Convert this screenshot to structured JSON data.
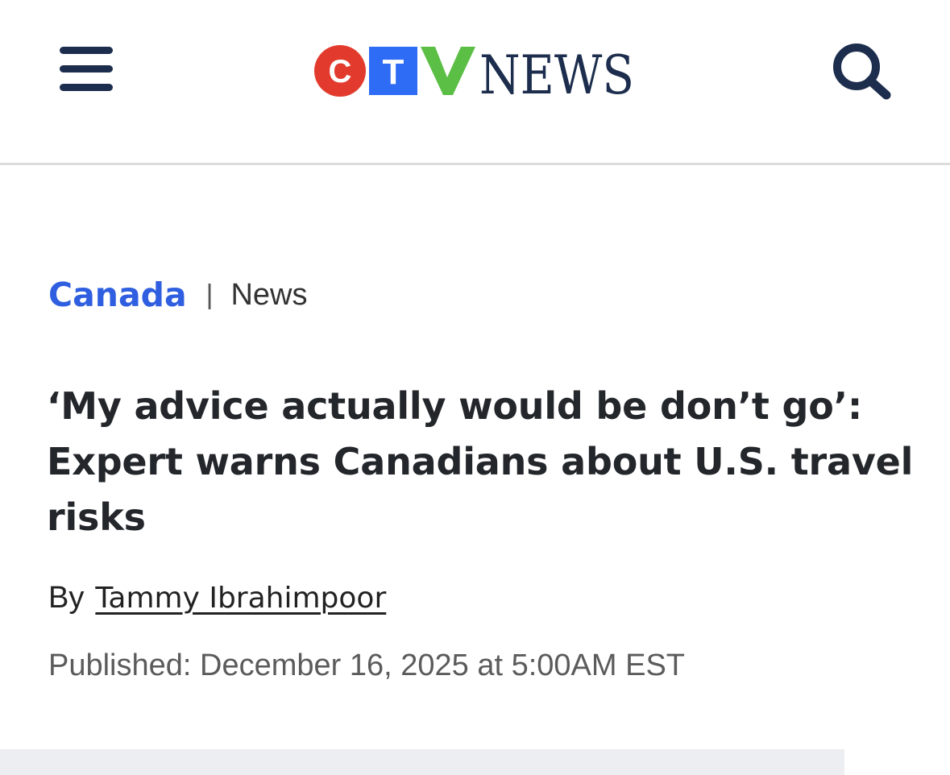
{
  "header": {
    "menu_icon": "hamburger-menu-icon",
    "logo": {
      "letters": [
        "C",
        "T",
        "V"
      ],
      "wordmark": "NEWS",
      "colors": {
        "c_circle": "#e23b2e",
        "t_square": "#2f6cf5",
        "v_check": "#5bbf45",
        "wordmark": "#1c2d4d"
      }
    },
    "search_icon": "search-icon"
  },
  "breadcrumb": {
    "section": "Canada",
    "separator": "|",
    "subsection": "News"
  },
  "article": {
    "headline": "‘My advice actually would be don’t go’: Expert warns Canadians about U.S. travel risks",
    "byline_prefix": "By",
    "author": "Tammy Ibrahimpoor",
    "published": "Published: December 16, 2025 at 5:00AM EST"
  },
  "colors": {
    "accent": "#2f5fe0",
    "navy": "#1c2d4d",
    "headline_text": "#23262b",
    "muted_text": "#5b5b5b",
    "divider": "#dcdcdc",
    "band": "#edeef2"
  }
}
